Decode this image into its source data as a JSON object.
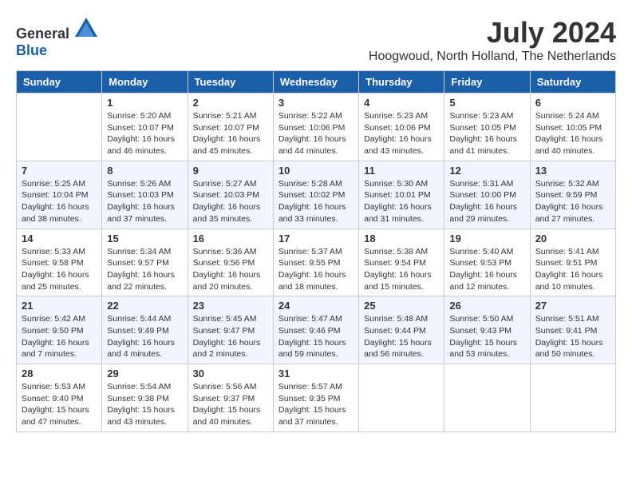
{
  "logo": {
    "general": "General",
    "blue": "Blue"
  },
  "title": {
    "month_year": "July 2024",
    "location": "Hoogwoud, North Holland, The Netherlands"
  },
  "calendar": {
    "headers": [
      "Sunday",
      "Monday",
      "Tuesday",
      "Wednesday",
      "Thursday",
      "Friday",
      "Saturday"
    ],
    "weeks": [
      [
        {
          "day": "",
          "sunrise": "",
          "sunset": "",
          "daylight": ""
        },
        {
          "day": "1",
          "sunrise": "Sunrise: 5:20 AM",
          "sunset": "Sunset: 10:07 PM",
          "daylight": "Daylight: 16 hours and 46 minutes."
        },
        {
          "day": "2",
          "sunrise": "Sunrise: 5:21 AM",
          "sunset": "Sunset: 10:07 PM",
          "daylight": "Daylight: 16 hours and 45 minutes."
        },
        {
          "day": "3",
          "sunrise": "Sunrise: 5:22 AM",
          "sunset": "Sunset: 10:06 PM",
          "daylight": "Daylight: 16 hours and 44 minutes."
        },
        {
          "day": "4",
          "sunrise": "Sunrise: 5:23 AM",
          "sunset": "Sunset: 10:06 PM",
          "daylight": "Daylight: 16 hours and 43 minutes."
        },
        {
          "day": "5",
          "sunrise": "Sunrise: 5:23 AM",
          "sunset": "Sunset: 10:05 PM",
          "daylight": "Daylight: 16 hours and 41 minutes."
        },
        {
          "day": "6",
          "sunrise": "Sunrise: 5:24 AM",
          "sunset": "Sunset: 10:05 PM",
          "daylight": "Daylight: 16 hours and 40 minutes."
        }
      ],
      [
        {
          "day": "7",
          "sunrise": "Sunrise: 5:25 AM",
          "sunset": "Sunset: 10:04 PM",
          "daylight": "Daylight: 16 hours and 38 minutes."
        },
        {
          "day": "8",
          "sunrise": "Sunrise: 5:26 AM",
          "sunset": "Sunset: 10:03 PM",
          "daylight": "Daylight: 16 hours and 37 minutes."
        },
        {
          "day": "9",
          "sunrise": "Sunrise: 5:27 AM",
          "sunset": "Sunset: 10:03 PM",
          "daylight": "Daylight: 16 hours and 35 minutes."
        },
        {
          "day": "10",
          "sunrise": "Sunrise: 5:28 AM",
          "sunset": "Sunset: 10:02 PM",
          "daylight": "Daylight: 16 hours and 33 minutes."
        },
        {
          "day": "11",
          "sunrise": "Sunrise: 5:30 AM",
          "sunset": "Sunset: 10:01 PM",
          "daylight": "Daylight: 16 hours and 31 minutes."
        },
        {
          "day": "12",
          "sunrise": "Sunrise: 5:31 AM",
          "sunset": "Sunset: 10:00 PM",
          "daylight": "Daylight: 16 hours and 29 minutes."
        },
        {
          "day": "13",
          "sunrise": "Sunrise: 5:32 AM",
          "sunset": "Sunset: 9:59 PM",
          "daylight": "Daylight: 16 hours and 27 minutes."
        }
      ],
      [
        {
          "day": "14",
          "sunrise": "Sunrise: 5:33 AM",
          "sunset": "Sunset: 9:58 PM",
          "daylight": "Daylight: 16 hours and 25 minutes."
        },
        {
          "day": "15",
          "sunrise": "Sunrise: 5:34 AM",
          "sunset": "Sunset: 9:57 PM",
          "daylight": "Daylight: 16 hours and 22 minutes."
        },
        {
          "day": "16",
          "sunrise": "Sunrise: 5:36 AM",
          "sunset": "Sunset: 9:56 PM",
          "daylight": "Daylight: 16 hours and 20 minutes."
        },
        {
          "day": "17",
          "sunrise": "Sunrise: 5:37 AM",
          "sunset": "Sunset: 9:55 PM",
          "daylight": "Daylight: 16 hours and 18 minutes."
        },
        {
          "day": "18",
          "sunrise": "Sunrise: 5:38 AM",
          "sunset": "Sunset: 9:54 PM",
          "daylight": "Daylight: 16 hours and 15 minutes."
        },
        {
          "day": "19",
          "sunrise": "Sunrise: 5:40 AM",
          "sunset": "Sunset: 9:53 PM",
          "daylight": "Daylight: 16 hours and 12 minutes."
        },
        {
          "day": "20",
          "sunrise": "Sunrise: 5:41 AM",
          "sunset": "Sunset: 9:51 PM",
          "daylight": "Daylight: 16 hours and 10 minutes."
        }
      ],
      [
        {
          "day": "21",
          "sunrise": "Sunrise: 5:42 AM",
          "sunset": "Sunset: 9:50 PM",
          "daylight": "Daylight: 16 hours and 7 minutes."
        },
        {
          "day": "22",
          "sunrise": "Sunrise: 5:44 AM",
          "sunset": "Sunset: 9:49 PM",
          "daylight": "Daylight: 16 hours and 4 minutes."
        },
        {
          "day": "23",
          "sunrise": "Sunrise: 5:45 AM",
          "sunset": "Sunset: 9:47 PM",
          "daylight": "Daylight: 16 hours and 2 minutes."
        },
        {
          "day": "24",
          "sunrise": "Sunrise: 5:47 AM",
          "sunset": "Sunset: 9:46 PM",
          "daylight": "Daylight: 15 hours and 59 minutes."
        },
        {
          "day": "25",
          "sunrise": "Sunrise: 5:48 AM",
          "sunset": "Sunset: 9:44 PM",
          "daylight": "Daylight: 15 hours and 56 minutes."
        },
        {
          "day": "26",
          "sunrise": "Sunrise: 5:50 AM",
          "sunset": "Sunset: 9:43 PM",
          "daylight": "Daylight: 15 hours and 53 minutes."
        },
        {
          "day": "27",
          "sunrise": "Sunrise: 5:51 AM",
          "sunset": "Sunset: 9:41 PM",
          "daylight": "Daylight: 15 hours and 50 minutes."
        }
      ],
      [
        {
          "day": "28",
          "sunrise": "Sunrise: 5:53 AM",
          "sunset": "Sunset: 9:40 PM",
          "daylight": "Daylight: 15 hours and 47 minutes."
        },
        {
          "day": "29",
          "sunrise": "Sunrise: 5:54 AM",
          "sunset": "Sunset: 9:38 PM",
          "daylight": "Daylight: 15 hours and 43 minutes."
        },
        {
          "day": "30",
          "sunrise": "Sunrise: 5:56 AM",
          "sunset": "Sunset: 9:37 PM",
          "daylight": "Daylight: 15 hours and 40 minutes."
        },
        {
          "day": "31",
          "sunrise": "Sunrise: 5:57 AM",
          "sunset": "Sunset: 9:35 PM",
          "daylight": "Daylight: 15 hours and 37 minutes."
        },
        {
          "day": "",
          "sunrise": "",
          "sunset": "",
          "daylight": ""
        },
        {
          "day": "",
          "sunrise": "",
          "sunset": "",
          "daylight": ""
        },
        {
          "day": "",
          "sunrise": "",
          "sunset": "",
          "daylight": ""
        }
      ]
    ]
  }
}
